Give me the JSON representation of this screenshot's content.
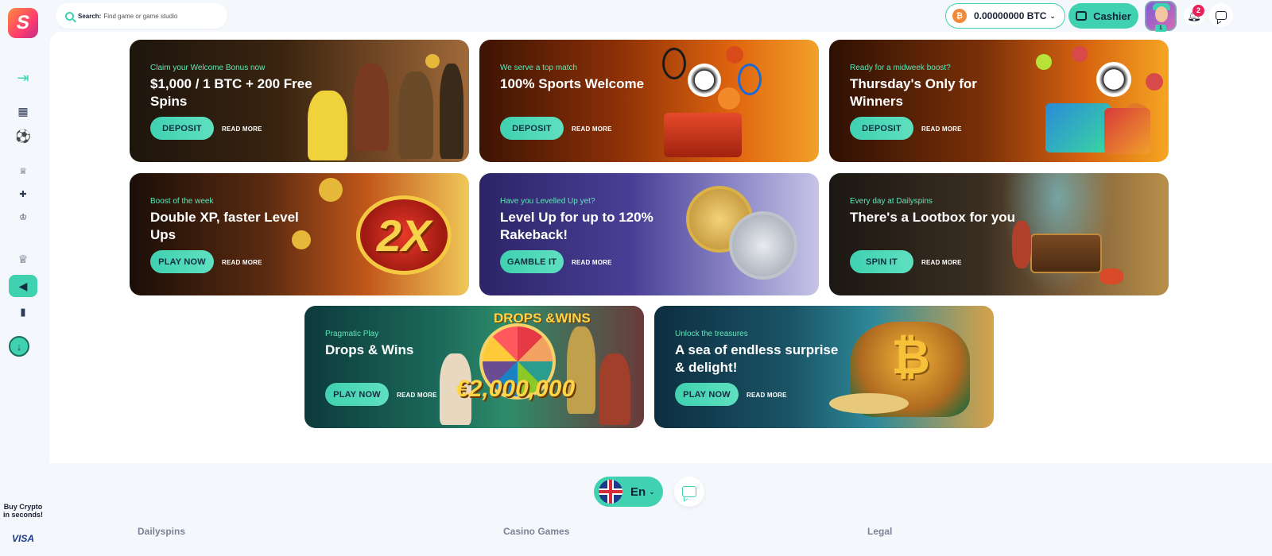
{
  "header": {
    "search": {
      "label": "Search:",
      "placeholder": "Find game or game studio"
    },
    "balance": {
      "amount": "0.00000000 BTC",
      "currency_icon": "bitcoin-icon"
    },
    "cashier_label": "Cashier",
    "level": "1",
    "notifications_count": "2"
  },
  "sidebar": {
    "items": [
      {
        "icon": "expand-menu-icon"
      },
      {
        "icon": "casino-icon"
      },
      {
        "icon": "sports-ball-icon"
      },
      {
        "icon": "tournaments-icon"
      },
      {
        "icon": "gift-icon"
      },
      {
        "icon": "trophy-small-icon"
      },
      {
        "icon": "trophy-icon"
      },
      {
        "icon": "megaphone-icon",
        "active": true
      },
      {
        "icon": "stats-icon"
      },
      {
        "icon": "download-icon"
      }
    ],
    "buy_crypto": "Buy Crypto in seconds!",
    "visa": "VISA"
  },
  "banners": [
    {
      "kicker": "Claim your Welcome Bonus now",
      "title": "$1,000 / 1 BTC + 200 Free Spins",
      "cta": "DEPOSIT",
      "more": "READ MORE"
    },
    {
      "kicker": "We serve a top match",
      "title": "100% Sports Welcome",
      "cta": "DEPOSIT",
      "more": "READ MORE"
    },
    {
      "kicker": "Ready for a midweek boost?",
      "title": "Thursday's Only for Winners",
      "cta": "DEPOSIT",
      "more": "READ MORE"
    },
    {
      "kicker": "Boost of the week",
      "title": "Double XP, faster Level Ups",
      "cta": "PLAY NOW",
      "more": "READ MORE",
      "art_text": "2X"
    },
    {
      "kicker": "Have you Levelled Up yet?",
      "title": "Level Up for up to 120% Rakeback!",
      "cta": "GAMBLE IT",
      "more": "READ MORE"
    },
    {
      "kicker": "Every day at Dailyspins",
      "title": "There's a Lootbox for you",
      "cta": "SPIN IT",
      "more": "READ MORE"
    },
    {
      "kicker": "Pragmatic Play",
      "title": "Drops & Wins",
      "cta": "PLAY NOW",
      "more": "READ MORE",
      "art_title": "DROPS &WINS",
      "art_sum": "€2,000,000"
    },
    {
      "kicker": "Unlock the treasures",
      "title": "A sea of endless surprise & delight!",
      "cta": "PLAY NOW",
      "more": "READ MORE",
      "art_text": "₿"
    }
  ],
  "footer": {
    "language": "En",
    "columns": [
      "Dailyspins",
      "Casino Games",
      "Legal"
    ]
  },
  "colors": {
    "accent": "#3fd1b0",
    "notification": "#e8235a",
    "bitcoin": "#f08a3a"
  }
}
